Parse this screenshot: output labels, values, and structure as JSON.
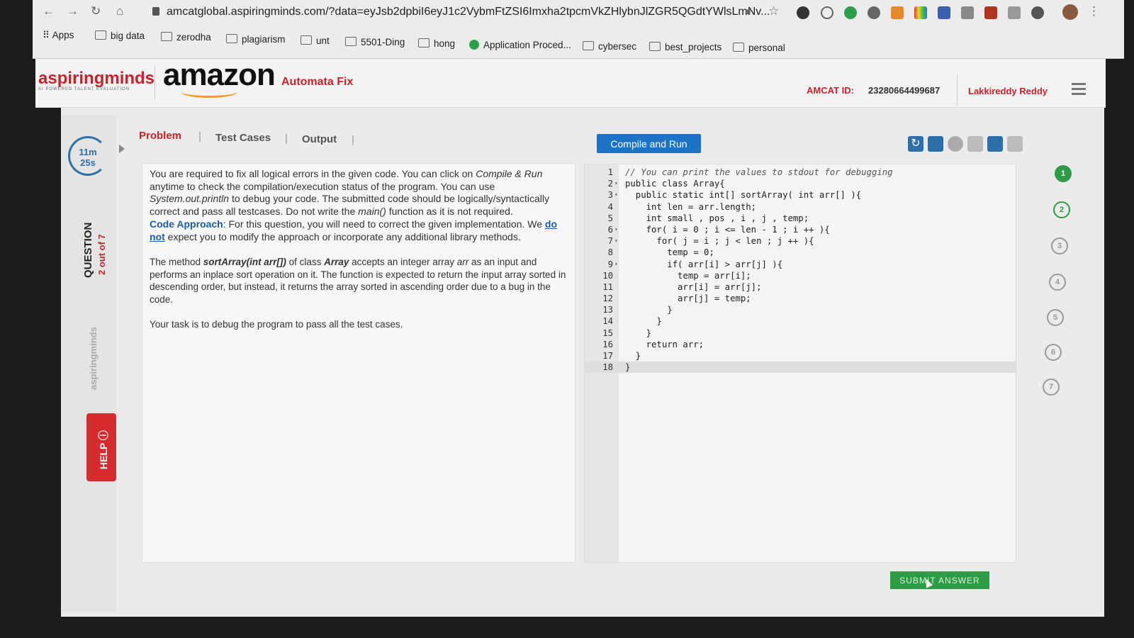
{
  "browser": {
    "url": "amcatglobal.aspiringminds.com/?data=eyJsb2dpbiI6eyJ1c2VybmFtZSI6Imxha2tpcmVkZHlybnJlZGR5QGdtYWlsLmNv...",
    "bookmarks": [
      "Apps",
      "big data",
      "zerodha",
      "plagiarism",
      "unt",
      "5501-Ding",
      "hong",
      "Application Proced...",
      "cybersec",
      "best_projects",
      "personal"
    ]
  },
  "header": {
    "brand": "aspiringminds",
    "brand_tagline": "AI POWERED TALENT EVALUATION",
    "partner": "amazon",
    "module_title": "Automata Fix",
    "amcat_label": "AMCAT ID:",
    "amcat_id": "23280664499687",
    "user_name": "Lakkireddy Reddy"
  },
  "sidebar": {
    "timer_minutes": "11m",
    "timer_seconds": "25s",
    "question_label": "QUESTION",
    "question_progress": "2 out of 7",
    "watermark": "aspiringminds",
    "help_label": "HELP"
  },
  "tabs": [
    "Problem",
    "Test Cases",
    "Output"
  ],
  "problem": {
    "p1_a": "You are required to fix all logical errors in the given code. You can click on ",
    "p1_b": "Compile & Run",
    "p1_c": " anytime to check the compilation/execution status of the program. You can use ",
    "p1_d": "System.out.println",
    "p1_e": " to debug your code. The submitted code should be logically/syntactically correct and pass all testcases. Do not write the ",
    "p1_f": "main()",
    "p1_g": " function as it is not required.",
    "p2_a": "Code Approach",
    "p2_b": ": For this question, you will need to correct the given implementation. We ",
    "p2_c": "do not",
    "p2_d": " expect you to modify the approach or incorporate any additional library methods.",
    "p3_a": "The method ",
    "p3_b": "sortArray(int arr[])",
    "p3_c": " of class ",
    "p3_d": "Array",
    "p3_e": " accepts an integer array ",
    "p3_f": "arr",
    "p3_g": " as an input and performs an inplace sort operation on it. The function is expected to return the input array sorted in descending order, but instead, it returns the array sorted in ascending order due to a bug in the code.",
    "p4": "Your task is to debug the program to pass all the test cases."
  },
  "editor": {
    "compile_label": "Compile and Run",
    "toolbar_icons": [
      "reset-icon",
      "save-icon",
      "theme-icon",
      "layout-split-icon",
      "layout-bottom-icon",
      "layout-side-icon"
    ],
    "lines": [
      "// You can print the values to stdout for debugging",
      "public class Array{",
      "  public static int[] sortArray( int arr[] ){",
      "    int len = arr.length;",
      "    int small , pos , i , j , temp;",
      "    for( i = 0 ; i <= len - 1 ; i ++ ){",
      "      for( j = i ; j < len ; j ++ ){",
      "        temp = 0;",
      "        if( arr[i] > arr[j] ){",
      "          temp = arr[i];",
      "          arr[i] = arr[j];",
      "          arr[j] = temp;",
      "        }",
      "      }",
      "    }",
      "    return arr;",
      "  }",
      "}"
    ],
    "foldable_lines": [
      2,
      3,
      6,
      7,
      9
    ],
    "active_line": 18
  },
  "questions": {
    "items": [
      "1",
      "2",
      "3",
      "4",
      "5",
      "6",
      "7"
    ],
    "current": 2,
    "colors": {
      "answered": "#2e9b47",
      "current": "#2e9b47",
      "pending": "#9a9a9a"
    }
  },
  "submit_label": "SUBMIT ANSWER",
  "colors": {
    "brand_red": "#c8222b",
    "primary_blue": "#1d74c7",
    "submit_green": "#2e9b47"
  }
}
